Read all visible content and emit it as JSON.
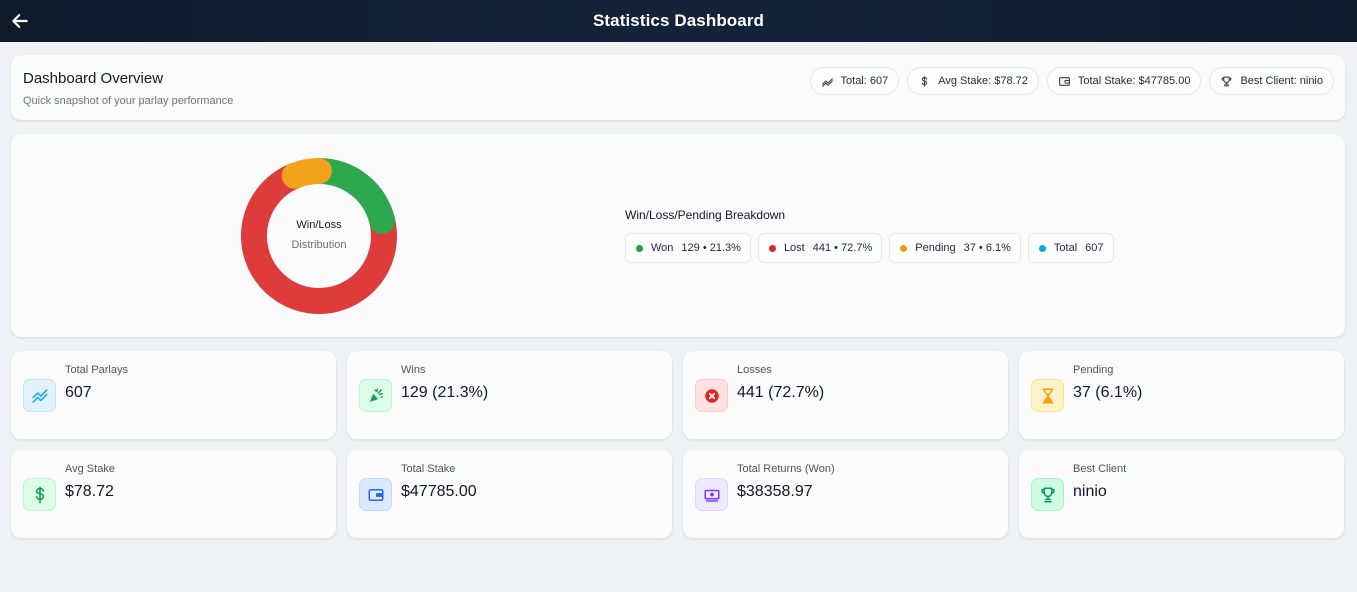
{
  "header": {
    "title": "Statistics Dashboard",
    "back_icon": "arrow-left-icon"
  },
  "overview": {
    "title": "Dashboard Overview",
    "subtitle": "Quick snapshot of your parlay performance",
    "chips": [
      {
        "icon": "trend-icon",
        "label": "Total: 607"
      },
      {
        "icon": "dollar-icon",
        "label": "Avg Stake: $78.72"
      },
      {
        "icon": "wallet-icon",
        "label": "Total Stake: $47785.00"
      },
      {
        "icon": "trophy-icon",
        "label": "Best Client: ninio"
      }
    ]
  },
  "distribution": {
    "center_title": "Win/Loss",
    "center_subtitle": "Distribution",
    "breakdown_title": "Win/Loss/Pending Breakdown",
    "legend": [
      {
        "name": "Won",
        "value": "129 • 21.3%",
        "color": "#16a34a"
      },
      {
        "name": "Lost",
        "value": "441 • 72.7%",
        "color": "#dc2626"
      },
      {
        "name": "Pending",
        "value": "37 • 6.1%",
        "color": "#f59e0b"
      },
      {
        "name": "Total",
        "value": "607",
        "color": "#0ea5e9"
      }
    ]
  },
  "chart_data": {
    "type": "pie",
    "categories": [
      "Won",
      "Lost",
      "Pending"
    ],
    "values": [
      129,
      441,
      37
    ],
    "colors": [
      "#2ea84f",
      "#de3b3b",
      "#f3a21b"
    ],
    "title": "Win/Loss",
    "subtitle": "Distribution"
  },
  "stats": [
    {
      "label": "Total Parlays",
      "value": "607",
      "icon": "trend-icon",
      "color": "#0ea5e9",
      "bg": "#e0f2fe",
      "border": "#bae6fd"
    },
    {
      "label": "Wins",
      "value": "129  (21.3%)",
      "icon": "party-popper-icon",
      "color": "#16a34a",
      "bg": "#dcfce7",
      "border": "#bbf7d0"
    },
    {
      "label": "Losses",
      "value": "441  (72.7%)",
      "icon": "x-circle-icon",
      "color": "#dc2626",
      "bg": "#fee2e2",
      "border": "#fecaca"
    },
    {
      "label": "Pending",
      "value": "37  (6.1%)",
      "icon": "hourglass-icon",
      "color": "#f59e0b",
      "bg": "#fef3c7",
      "border": "#fde68a"
    },
    {
      "label": "Avg Stake",
      "value": "$78.72",
      "icon": "dollar-icon",
      "color": "#16a34a",
      "bg": "#dcfce7",
      "border": "#bbf7d0"
    },
    {
      "label": "Total Stake",
      "value": "$47785.00",
      "icon": "wallet-icon",
      "color": "#2563eb",
      "bg": "#dbeafe",
      "border": "#bfdbfe"
    },
    {
      "label": "Total Returns (Won)",
      "value": "$38358.97",
      "icon": "cash-icon",
      "color": "#7c3aed",
      "bg": "#ede9fe",
      "border": "#ddd6fe"
    },
    {
      "label": "Best Client",
      "value": "ninio",
      "icon": "trophy-icon",
      "color": "#059669",
      "bg": "#d1fae5",
      "border": "#a7f3d0"
    }
  ]
}
